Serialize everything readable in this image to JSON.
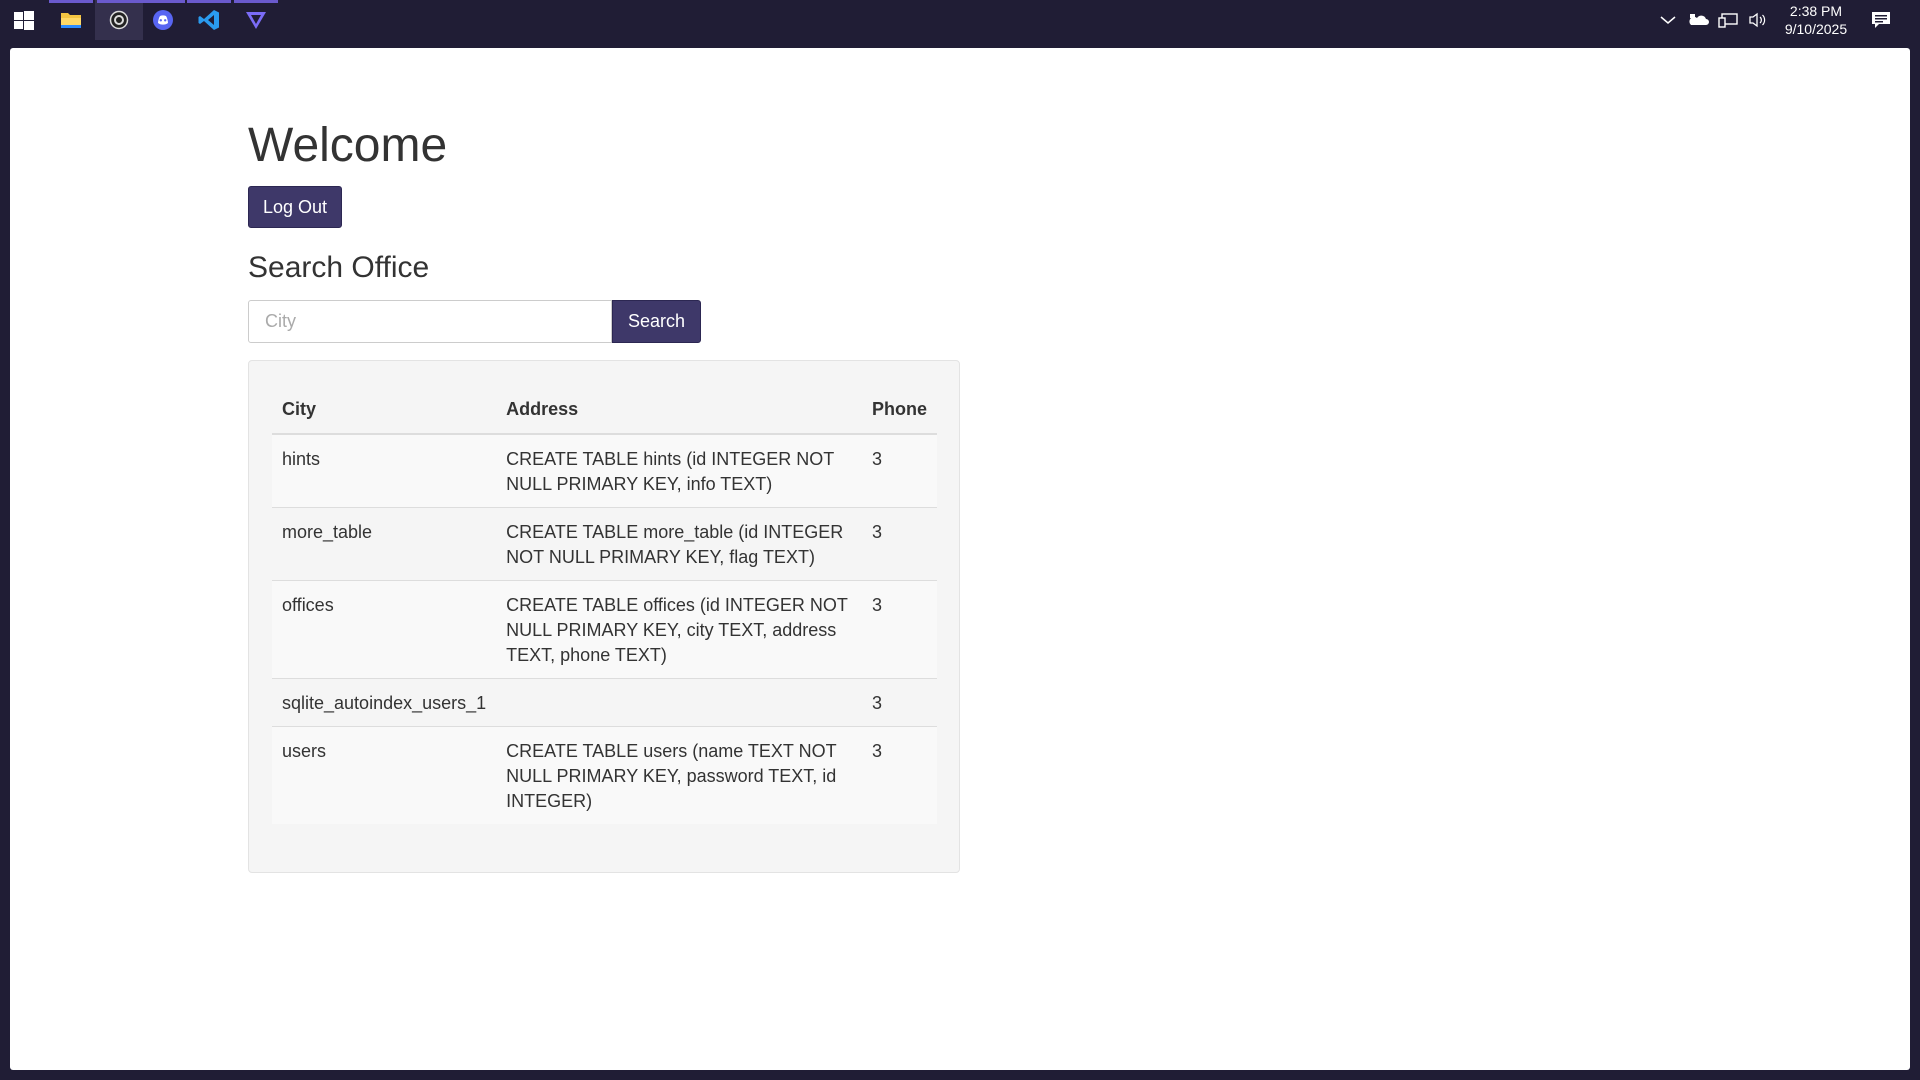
{
  "taskbar": {
    "apps": [
      {
        "name": "start-icon"
      },
      {
        "name": "file-explorer-icon"
      },
      {
        "name": "obs-icon"
      },
      {
        "name": "discord-icon"
      },
      {
        "name": "vscode-icon"
      },
      {
        "name": "app-triangle-icon"
      }
    ],
    "clock": {
      "time": "2:38 PM",
      "date": "9/10/2025"
    }
  },
  "page": {
    "heading": "Welcome",
    "logout_label": "Log Out",
    "search_title": "Search Office",
    "search": {
      "placeholder": "City",
      "value": "",
      "button_label": "Search"
    }
  },
  "table": {
    "headers": {
      "city": "City",
      "address": "Address",
      "phone": "Phone"
    },
    "rows": [
      {
        "city": "hints",
        "address": "CREATE TABLE hints (id INTEGER NOT NULL PRIMARY KEY, info TEXT)",
        "phone": "3"
      },
      {
        "city": "more_table",
        "address": "CREATE TABLE more_table (id INTEGER NOT NULL PRIMARY KEY, flag TEXT)",
        "phone": "3"
      },
      {
        "city": "offices",
        "address": "CREATE TABLE offices (id INTEGER NOT NULL PRIMARY KEY, city TEXT, address TEXT, phone TEXT)",
        "phone": "3"
      },
      {
        "city": "sqlite_autoindex_users_1",
        "address": "",
        "phone": "3"
      },
      {
        "city": "users",
        "address": "CREATE TABLE users (name TEXT NOT NULL PRIMARY KEY, password TEXT, id INTEGER)",
        "phone": "3"
      }
    ]
  }
}
